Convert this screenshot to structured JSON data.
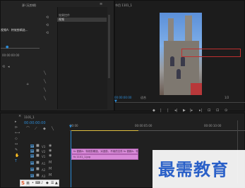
{
  "source_panel": {
    "tab_label": "源 (无剪辑)",
    "list_header": "效果控件",
    "list_item": "视频",
    "left_text_1": "视频A：特效剪辑选...",
    "left_text_2": "00:00:00:00",
    "timecode_small": "00:00:00:00"
  },
  "program_panel": {
    "tab_label": "节目 1101_1",
    "timecode": "00:00:00:00",
    "fit_label": "适合",
    "ratio_label": "1/2",
    "end_timecode": "00:00:06:00"
  },
  "timeline": {
    "tab_label": "1101_1",
    "timecode": "00:00:00:00",
    "ruler_labels": [
      "00:00",
      "00:00:05:00",
      "00:00:10:00"
    ],
    "tracks": [
      {
        "id": "V3"
      },
      {
        "id": "V2"
      },
      {
        "id": "V1"
      },
      {
        "id": "A1"
      },
      {
        "id": "A2"
      },
      {
        "id": "A3"
      },
      {
        "id": "主声道"
      }
    ],
    "clip_v2_label": "fx 视频A：特效剪辑选，对选剪，不用的文件 fx 视频A：特效剪辑选，对选剪辑选",
    "clip_v1_label": "fx 1101_1.jpg"
  },
  "watermark": {
    "text": "最需教育"
  },
  "taskbar": {
    "lang": "英",
    "items": [
      "S",
      "英",
      "•",
      "⌨",
      "🎤",
      "⚙",
      "☰",
      "👕"
    ]
  },
  "colors": {
    "accent": "#2c8bd6",
    "clip_pink": "#d88ad8",
    "watermark_blue": "#2a60c8"
  }
}
